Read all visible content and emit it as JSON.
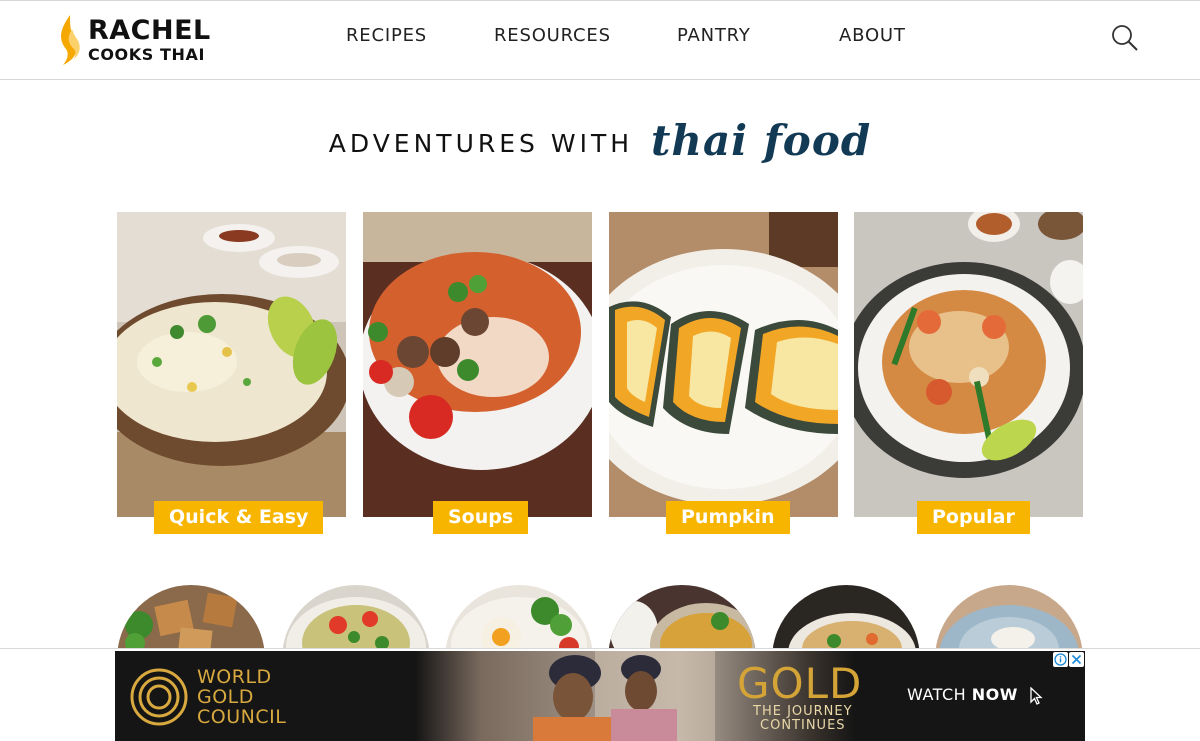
{
  "brand": {
    "line1": "RACHEL",
    "line2": "COOKS THAI",
    "flame_color": "#f5a800"
  },
  "nav": {
    "items": [
      "RECIPES",
      "RESOURCES",
      "PANTRY",
      "ABOUT"
    ]
  },
  "search": {
    "icon": "search-icon"
  },
  "tagline": {
    "caps": "ADVENTURES WITH",
    "script": "thai food"
  },
  "categories": [
    {
      "label": "Quick & Easy",
      "image": "fried-rice-photo"
    },
    {
      "label": "Soups",
      "image": "tom-yum-soup-photo"
    },
    {
      "label": "Pumpkin",
      "image": "pumpkin-custard-photo"
    },
    {
      "label": "Popular",
      "image": "pad-thai-photo"
    }
  ],
  "circles": [
    {
      "image": "fried-tofu-photo"
    },
    {
      "image": "papaya-salad-photo"
    },
    {
      "image": "fried-egg-basil-photo"
    },
    {
      "image": "curry-rice-photo"
    },
    {
      "image": "noodle-bowl-photo"
    },
    {
      "image": "rice-plate-photo"
    }
  ],
  "ad": {
    "brand_lines": [
      "WORLD",
      "GOLD",
      "COUNCIL"
    ],
    "headline": "GOLD",
    "subline1": "THE JOURNEY",
    "subline2": "CONTINUES",
    "cta_prefix": "WATCH ",
    "cta_bold": "NOW",
    "accent": "#d4a437"
  },
  "colors": {
    "label_bg": "#f7b500",
    "script_text": "#123a55"
  }
}
